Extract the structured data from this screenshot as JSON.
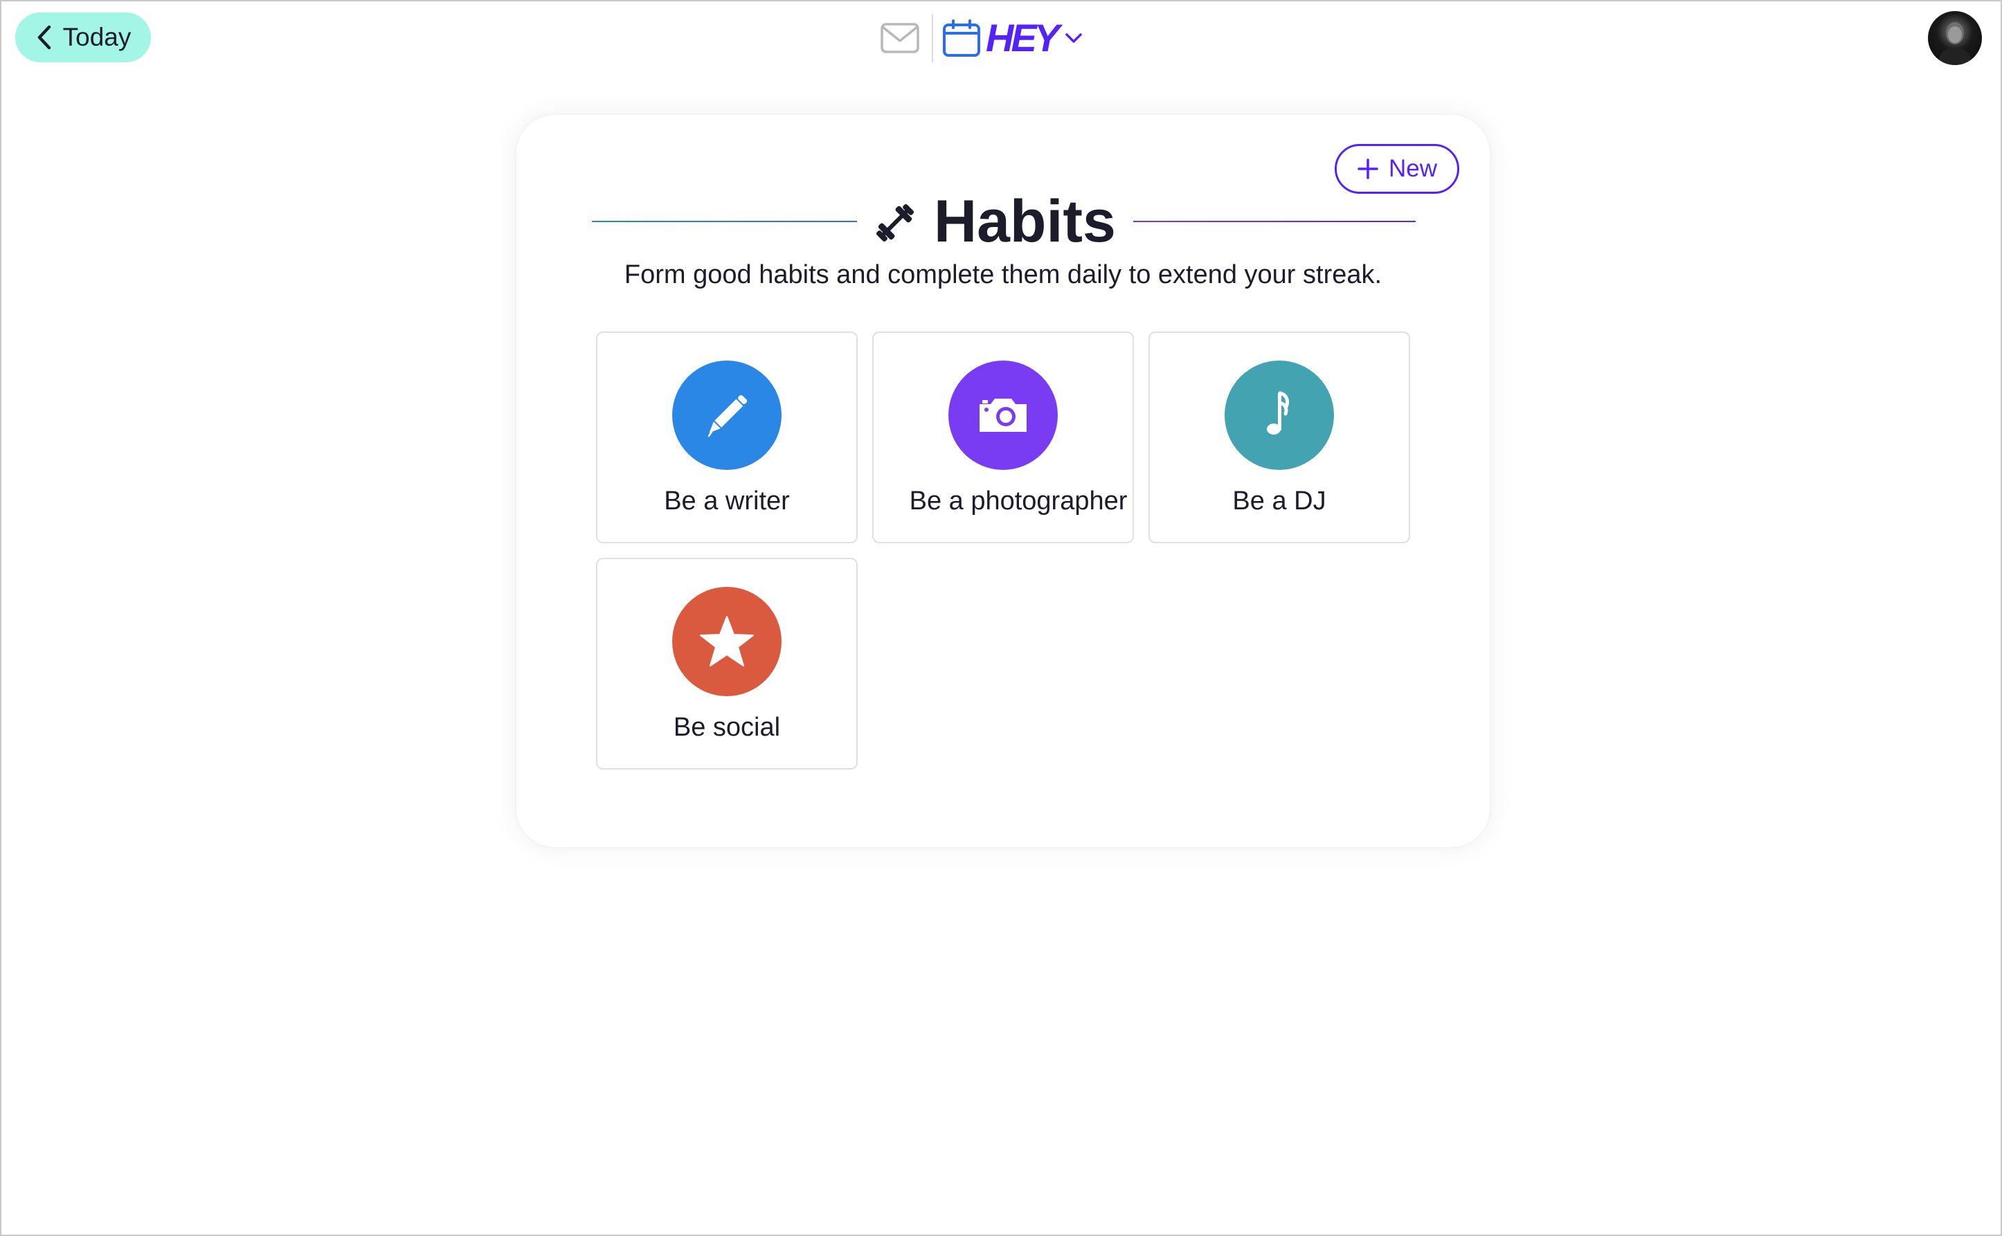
{
  "nav": {
    "back_label": "Today",
    "app_logo": "HEY",
    "icons": [
      "chevron-left-icon",
      "mail-icon",
      "calendar-icon",
      "chevron-down-icon"
    ]
  },
  "user": {
    "avatar": "user-avatar"
  },
  "page": {
    "new_label": "New",
    "title": "Habits",
    "title_icon": "dumbbell-icon",
    "subtitle": "Form good habits and complete them daily to extend your streak."
  },
  "habits": [
    {
      "label": "Be a writer",
      "icon": "pencil-icon",
      "color": "#2b87e6"
    },
    {
      "label": "Be a photographer",
      "icon": "camera-icon",
      "color": "#7a3cf2"
    },
    {
      "label": "Be a DJ",
      "icon": "music-note-icon",
      "color": "#43a3b1"
    },
    {
      "label": "Be social",
      "icon": "star-icon",
      "color": "#d95a3f"
    }
  ],
  "colors": {
    "back_button_bg": "#a3f5e6",
    "brand": "#5522fa",
    "text": "#1c1c2a"
  }
}
